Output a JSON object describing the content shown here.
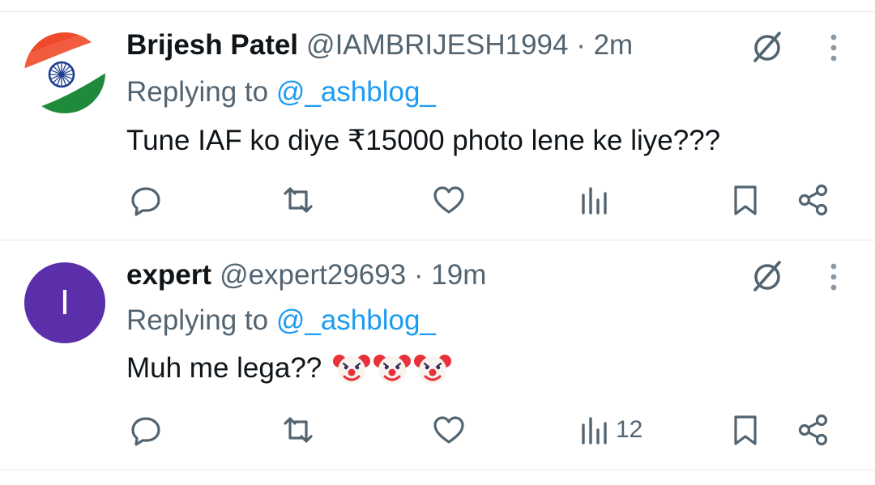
{
  "tweets": [
    {
      "name": "Brijesh Patel",
      "handle": "@IAMBRIJESH1994 · 2m",
      "replying_prefix": "Replying to ",
      "replying_to": "@_ashblog_",
      "text": "Tune IAF ko diye ₹15000 photo lene ke liye???",
      "avatar": "india-flag-chakra",
      "views_count": ""
    },
    {
      "name": "expert",
      "handle": "@expert29693 · 19m",
      "replying_prefix": "Replying to ",
      "replying_to": "@_ashblog_",
      "text": "Muh me lega??",
      "emoji_count": 3,
      "avatar_letter": "I",
      "avatar_color": "#5a2fa9",
      "views_count": "12"
    }
  ],
  "colors": {
    "link": "#1d9bf0",
    "secondary_text": "#536471",
    "icon": "#536471",
    "divider": "#e4e8ec"
  },
  "icons": [
    "reply-icon",
    "retweet-icon",
    "like-icon",
    "views-icon",
    "bookmark-icon",
    "share-icon",
    "grok-icon",
    "more-icon",
    "clown-emoji-icon"
  ]
}
